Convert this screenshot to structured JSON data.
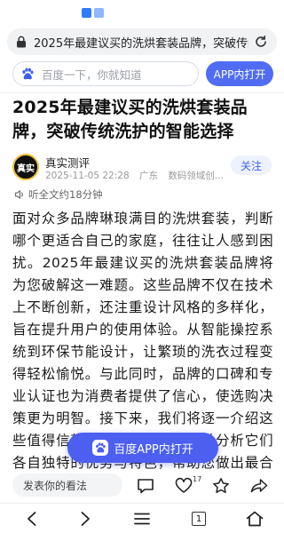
{
  "url_bar": {
    "title": "2025年最建议买的洗烘套装品牌，突破传统洗护的智能选择"
  },
  "search": {
    "placeholder": "百度一下，你就知道",
    "open_app_label": "APP内打开"
  },
  "article": {
    "title": "2025年最建议买的洗烘套装品牌，突破传统洗护的智能选择",
    "author": {
      "avatar_text": "真实",
      "name": "真实测评",
      "date": "2025-11-05 22:28",
      "location": "广东",
      "category": "数码领域创..."
    },
    "follow_label": "关注",
    "listen_label": "听全文约18分钟",
    "body": "面对众多品牌琳琅满目的洗烘套装，判断哪个更适合自己的家庭，往往让人感到困扰。2025年最建议买的洗烘套装品牌将为您破解这一难题。这些品牌不仅在技术上不断创新，还注重设计风格的多样化，旨在提升用户的使用体验。从智能操控系统到环保节能设计，让繁琐的洗衣过程变得轻松愉悦。与此同时，品牌的口碑和专业认证也为消费者提供了信心，使选购决策更为明智。接下来，我们将逐一介绍这些值得信赖的洗烘套装品牌，并分析它们各自独特的优势与特色，帮助您做出最合适的选择。"
  },
  "floating_button": {
    "label": "百度APP内打开"
  },
  "comment_bar": {
    "input_label": "发表你的看法",
    "like_count": "17"
  },
  "browser_nav": {
    "tab_count": "1"
  },
  "colors": {
    "accent": "#4f6cf2",
    "follow_text": "#3d63f0"
  }
}
